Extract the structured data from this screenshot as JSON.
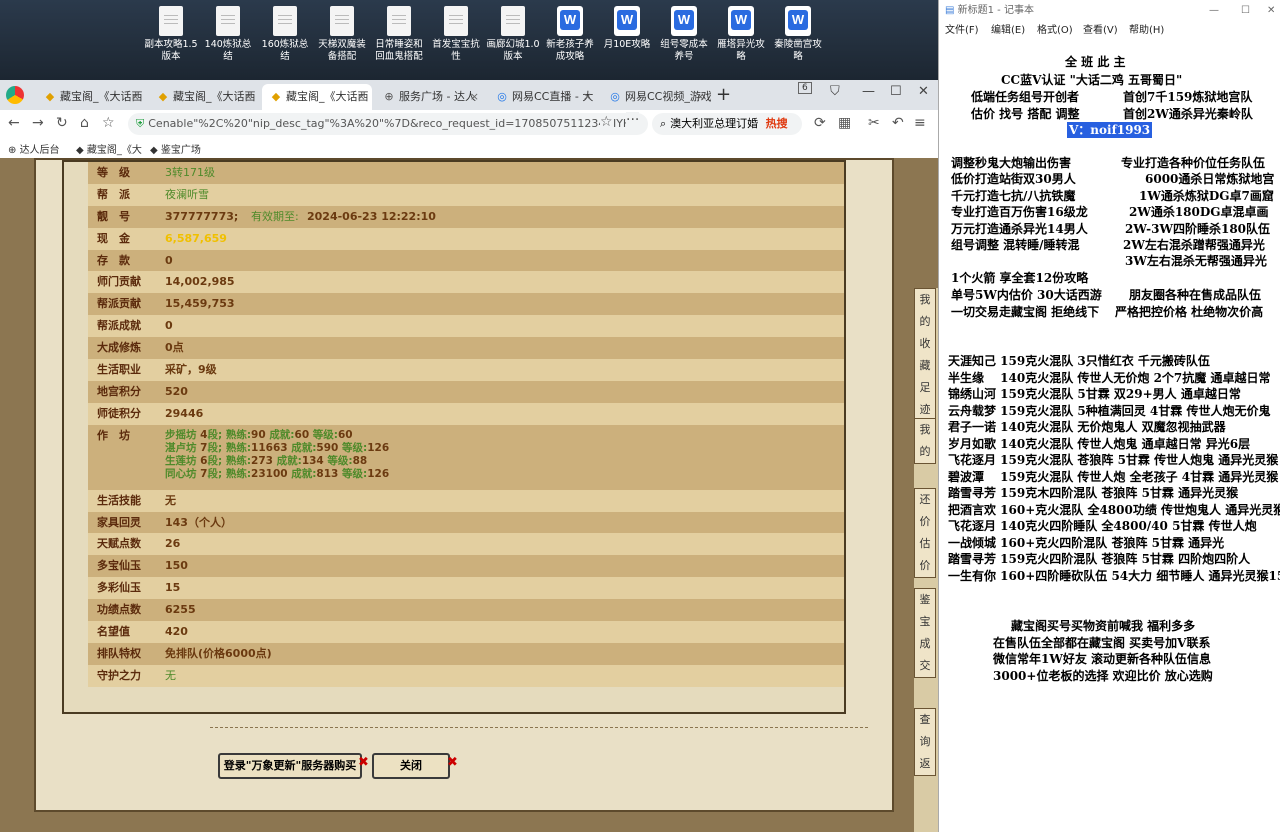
{
  "desktop": {
    "icons": [
      {
        "label": "副本攻略1.5版本",
        "type": "doc"
      },
      {
        "label": "140炼狱总结",
        "type": "doc"
      },
      {
        "label": "160炼狱总结",
        "type": "doc"
      },
      {
        "label": "天梯双魔装备搭配",
        "type": "doc"
      },
      {
        "label": "日常睡姿和回血鬼搭配",
        "type": "doc"
      },
      {
        "label": "首发宝宝抗性",
        "type": "doc"
      },
      {
        "label": "画廊幻城1.0版本",
        "type": "doc"
      },
      {
        "label": "新老孩子养成攻略",
        "type": "wps"
      },
      {
        "label": "月10E攻略",
        "type": "wps"
      },
      {
        "label": "组号零成本养号",
        "type": "wps"
      },
      {
        "label": "雁塔异光攻略",
        "type": "wps"
      },
      {
        "label": "秦陵凿宫攻略",
        "type": "wps"
      }
    ]
  },
  "browser": {
    "tabs": [
      {
        "label": "藏宝阁_《大话西",
        "active": false
      },
      {
        "label": "藏宝阁_《大话西",
        "active": false
      },
      {
        "label": "藏宝阁_《大话西",
        "active": true
      },
      {
        "label": "服务广场 - 达人",
        "active": false
      },
      {
        "label": "网易CC直播 - 大",
        "active": false
      },
      {
        "label": "网易CC视频_游戏",
        "active": false
      }
    ],
    "new_tab": "+",
    "tab_count": "6",
    "url": "Cenable\"%2C%20\"nip_desc_tag\"%3A%20\"%7D&reco_request_id=1708507511234BIYH9",
    "search_text": "澳大利亚总理订婚",
    "search_badge": "热搜",
    "bookmarks": [
      "达人后台",
      "藏宝阁_《大",
      "鉴宝广场"
    ]
  },
  "character": {
    "rows": [
      {
        "label": "等　级",
        "value": "3转171级",
        "style": "green"
      },
      {
        "label": "帮　派",
        "value": "夜澜听雪",
        "style": "green"
      },
      {
        "label": "靓　号",
        "value": "377777773;",
        "extra_label": "有效期至:",
        "extra_value": "2024-06-23 12:22:10",
        "style": "normal"
      },
      {
        "label": "现　金",
        "value": "6,587,659",
        "style": "gold"
      },
      {
        "label": "存　款",
        "value": "0",
        "style": "normal"
      },
      {
        "label": "师门贡献",
        "value": "14,002,985",
        "style": "normal"
      },
      {
        "label": "帮派贡献",
        "value": "15,459,753",
        "style": "normal"
      },
      {
        "label": "帮派成就",
        "value": "0",
        "style": "normal"
      },
      {
        "label": "大成修炼",
        "value": "0点",
        "style": "normal"
      },
      {
        "label": "生活职业",
        "value": "采矿，9级",
        "style": "normal"
      },
      {
        "label": "地宫积分",
        "value": "520",
        "style": "normal"
      },
      {
        "label": "师徒积分",
        "value": "29446",
        "style": "normal"
      }
    ],
    "workshop": {
      "label": "作　坊",
      "lines": [
        {
          "name": "步摇坊",
          "level": "4",
          "prof": "90",
          "ach": "60",
          "grade": "60"
        },
        {
          "name": "湛卢坊",
          "level": "7",
          "prof": "11663",
          "ach": "590",
          "grade": "126"
        },
        {
          "name": "生莲坊",
          "level": "6",
          "prof": "273",
          "ach": "134",
          "grade": "88"
        },
        {
          "name": "同心坊",
          "level": "7",
          "prof": "23100",
          "ach": "813",
          "grade": "126"
        }
      ],
      "seg_word": "段;",
      "prof_word": "熟练:",
      "ach_word": "成就:",
      "grade_word": "等级:"
    },
    "rows2": [
      {
        "label": "生活技能",
        "value": "无",
        "style": "normal"
      },
      {
        "label": "家具回灵",
        "value": "143（个人）",
        "style": "normal"
      },
      {
        "label": "天赋点数",
        "value": "26",
        "style": "normal"
      },
      {
        "label": "多宝仙玉",
        "value": "150",
        "style": "normal"
      },
      {
        "label": "多彩仙玉",
        "value": "15",
        "style": "normal"
      },
      {
        "label": "功绩点数",
        "value": "6255",
        "style": "normal"
      },
      {
        "label": "名望值",
        "value": "420",
        "style": "normal"
      },
      {
        "label": "排队特权",
        "value": "免排队(价格6000点)",
        "style": "normal"
      },
      {
        "label": "守护之力",
        "value": "无",
        "style": "green"
      }
    ]
  },
  "buttons": {
    "login": "登录\"万象更新\"服务器购买",
    "close": "关闭"
  },
  "right_strip": [
    "我",
    "的",
    "收",
    "藏",
    "足",
    "迹",
    "我",
    "的",
    "还",
    "价",
    "估",
    "价",
    "鉴",
    "宝",
    "成",
    "交",
    "查",
    "询",
    "返"
  ],
  "notepad": {
    "title": "新标题1 - 记事本",
    "menu": [
      "文件(F)",
      "编辑(E)",
      "格式(O)",
      "查看(V)",
      "帮助(H)"
    ],
    "header_partial": "全 班 此 主",
    "cc_line": "CC蓝V认证 \"大话二鸡 五哥蜀日\"",
    "top_left": [
      "低端任务组号开创者",
      "估价 找号 搭配 调整"
    ],
    "top_right": [
      "首创7千159炼狱地宫队",
      "首创2W通杀异光秦岭队"
    ],
    "wechat": "V：noif1993",
    "svc_left": [
      "调整秒鬼大炮输出伤害",
      "低价打造站街双30男人",
      "千元打造七抗/八抗铁魔",
      "专业打造百万伤害16级龙",
      "万元打造通杀异光14男人",
      "组号调整 混转睡/睡转混"
    ],
    "svc_right": [
      "专业打造各种价位任务队伍",
      "6000通杀日常炼狱地宫",
      "1W通杀炼狱DG卓7画窟",
      "2W通杀180DG卓混卓画",
      "2W-3W四阶睡杀180队伍",
      "2W左右混杀蹭帮强通异光",
      "3W左右混杀无帮强通异光"
    ],
    "arrow": "1个火箭 享全套12份攻略",
    "l1a": "单号5W内估价 30大话西游",
    "l1b": "朋友圈各种在售成品队伍",
    "l2a": "一切交易走藏宝阁 拒绝线下",
    "l2b": "严格把控价格 杜绝物次价高",
    "teams": [
      "天涯知己 159克火混队 3只惜红衣 千元搬砖队伍",
      "半生缘　 140克火混队 传世人无价炮 2个7抗魔 通卓越日常",
      "锦绣山河 159克火混队 5甘霖 双29+男人 通卓越日常",
      "云舟载梦 159克火混队 5种植满回灵 4甘霖 传世人炮无价鬼",
      "君子一诺 140克火混队 无价炮鬼人 双魔忽视抽武器",
      "岁月如歌 140克火混队 传世人炮鬼 通卓越日常 异光6层",
      "飞花逐月 159克火混队 苍狼阵 5甘霖 传世人炮鬼 通异光灵猴",
      "碧波潭　 159克火混队 传世人炮 全老孩子 4甘霖 通异光灵猴",
      "踏雪寻芳 159克木四阶混队 苍狼阵 5甘霖 通异光灵猴",
      "把酒言欢 160+克火混队 全4800功绩 传世炮鬼人 通异光灵猴",
      "飞花逐月 140克火四阶睡队 全4800/40 5甘霖 传世人炮",
      "一战倾城 160+克火四阶混队 苍狼阵 5甘霖 通异光",
      "踏雪寻芳 159克火四阶混队 苍狼阵 5甘霖 四阶炮四阶人",
      "一生有你 160+四阶睡砍队伍 54大力 细节睡人 通异光灵猴15"
    ],
    "footer": [
      "藏宝阁买号买物资前喊我 福利多多",
      "在售队伍全部都在藏宝阁 买卖号加V联系",
      "微信常年1W好友 滚动更新各种队伍信息",
      "3000+位老板的选择 欢迎比价 放心选购"
    ]
  }
}
